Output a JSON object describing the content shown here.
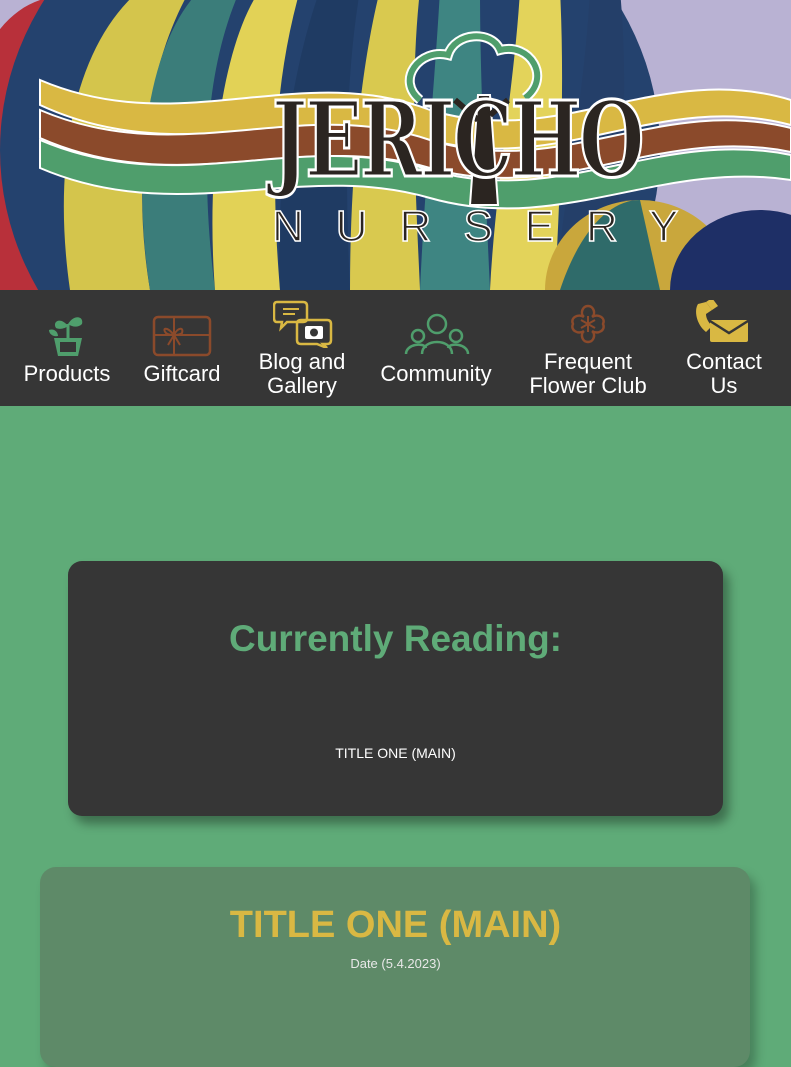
{
  "header": {
    "brand_main": "JERICHO",
    "brand_sub": "NURSERY"
  },
  "nav": {
    "items": [
      {
        "label": "Products",
        "icon": "plant-pot-icon"
      },
      {
        "label": "Giftcard",
        "icon": "gift-card-icon"
      },
      {
        "label": "Blog and\nGallery",
        "icon": "chat-camera-icon"
      },
      {
        "label": "Community",
        "icon": "people-group-icon"
      },
      {
        "label": "Frequent\nFlower Club",
        "icon": "flower-icon"
      },
      {
        "label": "Contact\nUs",
        "icon": "phone-envelope-icon"
      }
    ]
  },
  "reading": {
    "heading": "Currently Reading:",
    "item": "TITLE ONE (MAIN)"
  },
  "post": {
    "title": "TITLE ONE (MAIN)",
    "date": "Date (5.4.2023)"
  },
  "colors": {
    "page_green": "#5fab78",
    "dark": "#363636",
    "gold": "#d9b843",
    "brown": "#8b4a2b",
    "icon_green": "#4f9e6c"
  }
}
